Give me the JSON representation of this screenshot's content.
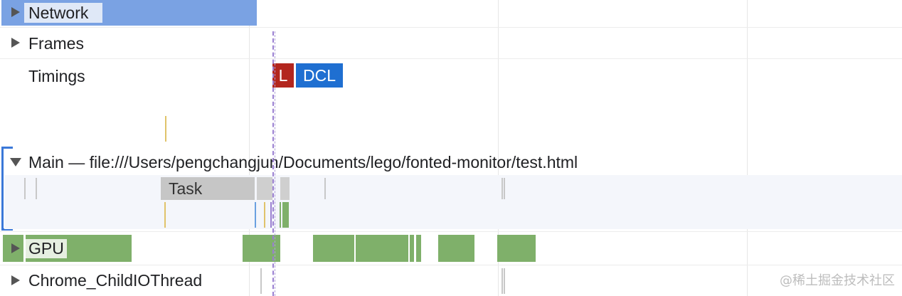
{
  "tracks": {
    "network": "Network",
    "frames": "Frames",
    "timings": "Timings",
    "main": "Main — file:///Users/pengchangjun/Documents/lego/fonted-monitor/test.html",
    "task": "Task",
    "gpu": "GPU",
    "io": "Chrome_ChildIOThread"
  },
  "markers": {
    "load": "L",
    "dcl": "DCL"
  },
  "colors": {
    "network_bar": "#7aa2e3",
    "load_marker": "#b3261e",
    "dcl_marker": "#1f6fd1",
    "gpu_bar": "#7fb06a",
    "task_bar": "#c6c6c6",
    "main_bg": "#f4f6fb",
    "selection": "#3b78d8"
  },
  "watermark": "@稀土掘金技术社区"
}
